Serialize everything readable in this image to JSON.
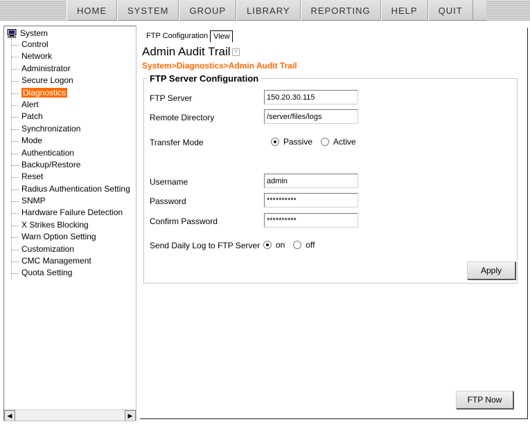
{
  "menu": {
    "items": [
      "HOME",
      "SYSTEM",
      "GROUP",
      "LIBRARY",
      "REPORTING",
      "HELP",
      "QUIT"
    ]
  },
  "sidebar": {
    "root_label": "System",
    "items": [
      {
        "label": "Control"
      },
      {
        "label": "Network"
      },
      {
        "label": "Administrator"
      },
      {
        "label": "Secure Logon"
      },
      {
        "label": "Diagnostics",
        "selected": true
      },
      {
        "label": "Alert"
      },
      {
        "label": "Patch"
      },
      {
        "label": "Synchronization"
      },
      {
        "label": "Mode"
      },
      {
        "label": "Authentication"
      },
      {
        "label": "Backup/Restore"
      },
      {
        "label": "Reset"
      },
      {
        "label": "Radius Authentication Setting"
      },
      {
        "label": "SNMP"
      },
      {
        "label": "Hardware Failure Detection"
      },
      {
        "label": "X Strikes Blocking"
      },
      {
        "label": "Warn Option Setting"
      },
      {
        "label": "Customization"
      },
      {
        "label": "CMC Management"
      },
      {
        "label": "Quota Setting"
      }
    ],
    "selected_color": "#ff6a00"
  },
  "main": {
    "tabs": [
      {
        "label": "FTP Configuration",
        "active": true
      },
      {
        "label": "View",
        "active": false
      }
    ],
    "title": "Admin Audit Trail",
    "help_icon": "help-icon",
    "breadcrumb": "System>Diagnostics>Admin Audit Trail",
    "breadcrumb_color": "#ff6a00",
    "section_title": "FTP Server Configuration",
    "fields": {
      "ftp_server": {
        "label": "FTP Server",
        "value": "150.20.30.115"
      },
      "remote_directory": {
        "label": "Remote Directory",
        "value": "/server/files/logs"
      },
      "transfer_mode": {
        "label": "Transfer Mode",
        "options": [
          "Passive",
          "Active"
        ],
        "selected": "Passive"
      },
      "username": {
        "label": "Username",
        "value": "admin"
      },
      "password": {
        "label": "Password",
        "value": "**********"
      },
      "confirm_password": {
        "label": "Confirm Password",
        "value": "**********"
      },
      "send_daily_log": {
        "label": "Send Daily Log to FTP Server",
        "options": [
          "on",
          "off"
        ],
        "selected": "on"
      }
    },
    "apply_label": "Apply",
    "ftp_now_label": "FTP Now"
  }
}
